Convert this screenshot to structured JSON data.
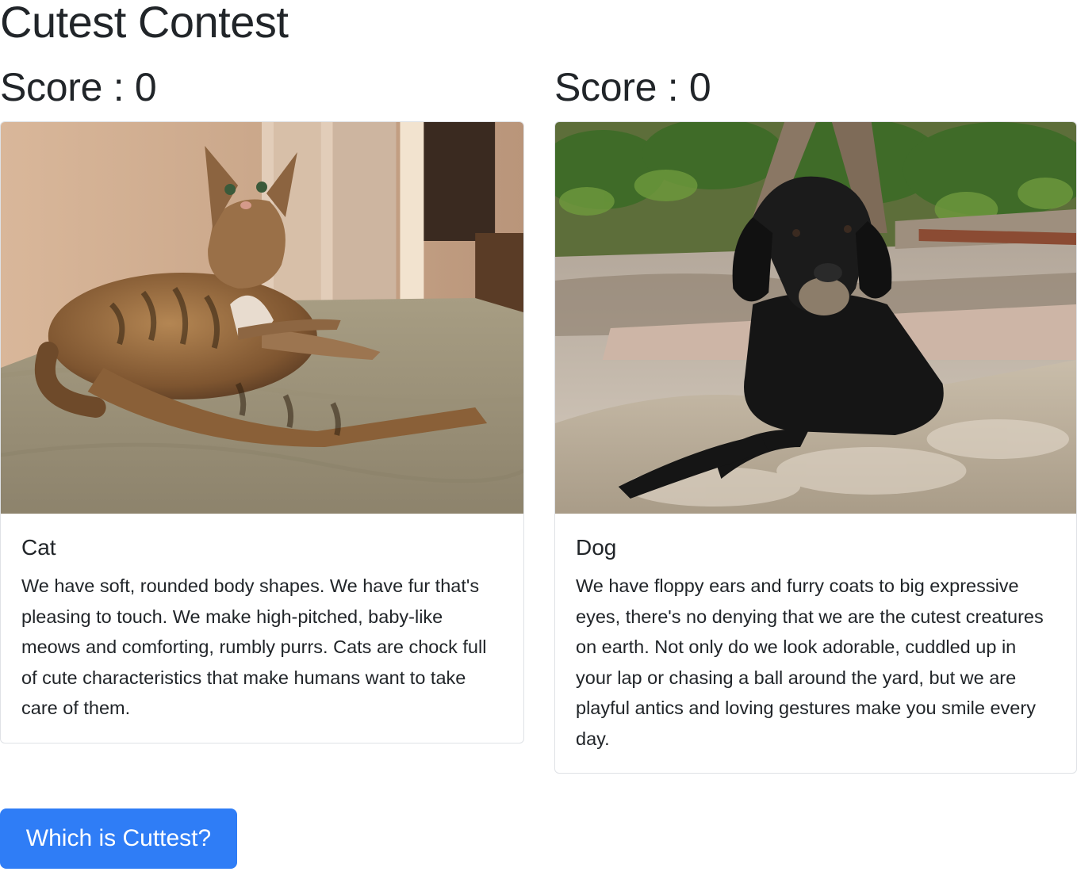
{
  "header": {
    "title": "Cutest Contest"
  },
  "contestants": [
    {
      "score_label": "Score : 0",
      "image_alt": "cat-photo",
      "name": "Cat",
      "description": "We have soft, rounded body shapes. We have fur that's pleasing to touch. We make high-pitched, baby-like meows and comforting, rumbly purrs. Cats are chock full of cute characteristics that make humans want to take care of them."
    },
    {
      "score_label": "Score : 0",
      "image_alt": "dog-photo",
      "name": "Dog",
      "description": "We have floppy ears and furry coats to big expressive eyes, there's no denying that we are the cutest creatures on earth. Not only do we look adorable, cuddled up in your lap or chasing a ball around the yard, but we are playful antics and loving gestures make you smile every day."
    }
  ],
  "actions": {
    "vote_label": "Which is Cuttest?"
  },
  "colors": {
    "primary_button": "#2f7df6",
    "text": "#212529",
    "card_border": "#dfe2e6"
  }
}
